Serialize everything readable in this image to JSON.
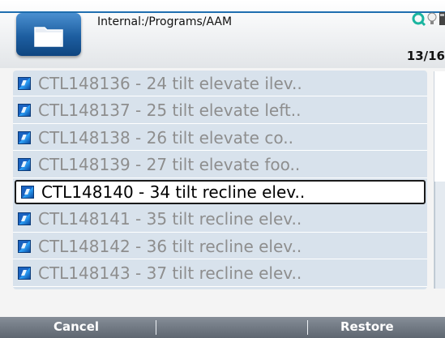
{
  "header": {
    "path": "Internal:/Programs/AAM",
    "counter": "13/16"
  },
  "list": {
    "items": [
      {
        "label": "CTL148136 - 24 tilt elevate ilev..",
        "selected": false
      },
      {
        "label": "CTL148137 - 25 tilt elevate left..",
        "selected": false
      },
      {
        "label": "CTL148138 - 26 tilt elevate co..",
        "selected": false
      },
      {
        "label": "CTL148139 - 27 tilt elevate foo..",
        "selected": false
      },
      {
        "label": "CTL148140 - 34 tilt recline elev..",
        "selected": true
      },
      {
        "label": "CTL148141 - 35 tilt recline elev..",
        "selected": false
      },
      {
        "label": "CTL148142 - 36 tilt recline elev..",
        "selected": false
      },
      {
        "label": "CTL148143 - 37 tilt recline elev..",
        "selected": false
      }
    ],
    "icon": "program-file-icon"
  },
  "footer": {
    "left_label": "Cancel",
    "right_label": "Restore"
  },
  "colors": {
    "accent": "#1f6fb0",
    "list_bg": "#d8e2ec",
    "dim_text": "#8e8e8e",
    "footer_bg": "#6e7680"
  }
}
